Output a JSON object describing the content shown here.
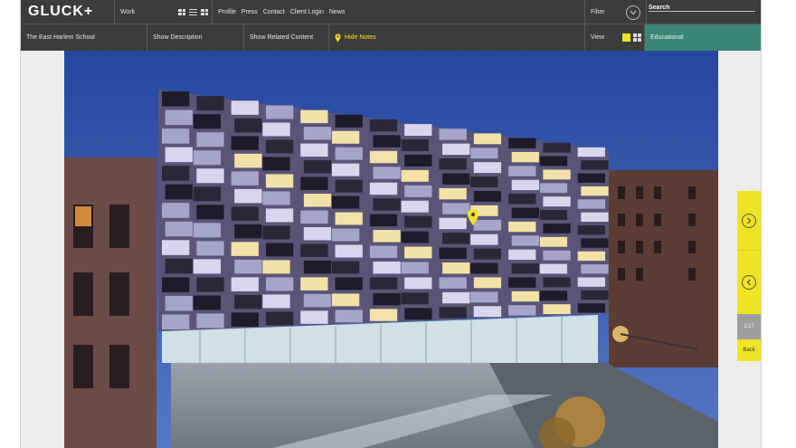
{
  "header": {
    "logo": "GLUCK+",
    "work_label": "Work",
    "nav": [
      "Profile",
      "Press",
      "Contact",
      "Client Login",
      "News"
    ],
    "filter_label": "Filter",
    "search_placeholder": "Search"
  },
  "subheader": {
    "project_title": "The East Harlem School",
    "show_description": "Show Description",
    "show_related": "Show Related Content",
    "hide_notes": "Hide Notes",
    "view_label": "View",
    "category": "Educational"
  },
  "pager": {
    "counter": "1/17",
    "back_label": "Back"
  },
  "colors": {
    "accent_yellow": "#f0e324",
    "teal": "#3a8575",
    "bar": "#3c3c3c"
  }
}
